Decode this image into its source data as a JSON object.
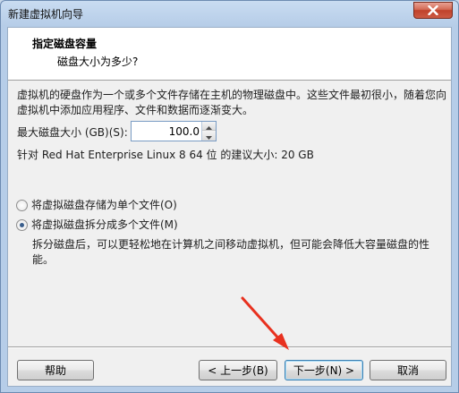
{
  "window": {
    "title": "新建虚拟机向导"
  },
  "header": {
    "title": "指定磁盘容量",
    "subtitle": "磁盘大小为多少?"
  },
  "content": {
    "description": "虚拟机的硬盘作为一个或多个文件存储在主机的物理磁盘中。这些文件最初很小，随着您向虚拟机中添加应用程序、文件和数据而逐渐变大。",
    "max_size_label": "最大磁盘大小 (GB)(S):",
    "max_size_value": "100.0",
    "recommendation": "针对 Red Hat Enterprise Linux 8 64 位 的建议大小: 20 GB",
    "radio_single": "将虚拟磁盘存储为单个文件(O)",
    "radio_split": "将虚拟磁盘拆分成多个文件(M)",
    "selected_option": "radio_split",
    "split_description": "拆分磁盘后，可以更轻松地在计算机之间移动虚拟机，但可能会降低大容量磁盘的性能。"
  },
  "buttons": {
    "help": "帮助",
    "back": "< 上一步(B)",
    "next": "下一步(N) >",
    "cancel": "取消"
  },
  "colors": {
    "title_bar": "#c9dcf1",
    "close_button": "#c0412a",
    "annotation_arrow": "#e8311f",
    "default_button_border": "#3c7fb1"
  },
  "icons": {
    "close": "close-icon",
    "spin_up": "chevron-up-icon",
    "spin_down": "chevron-down-icon",
    "annotation": "red-arrow-annotation"
  }
}
